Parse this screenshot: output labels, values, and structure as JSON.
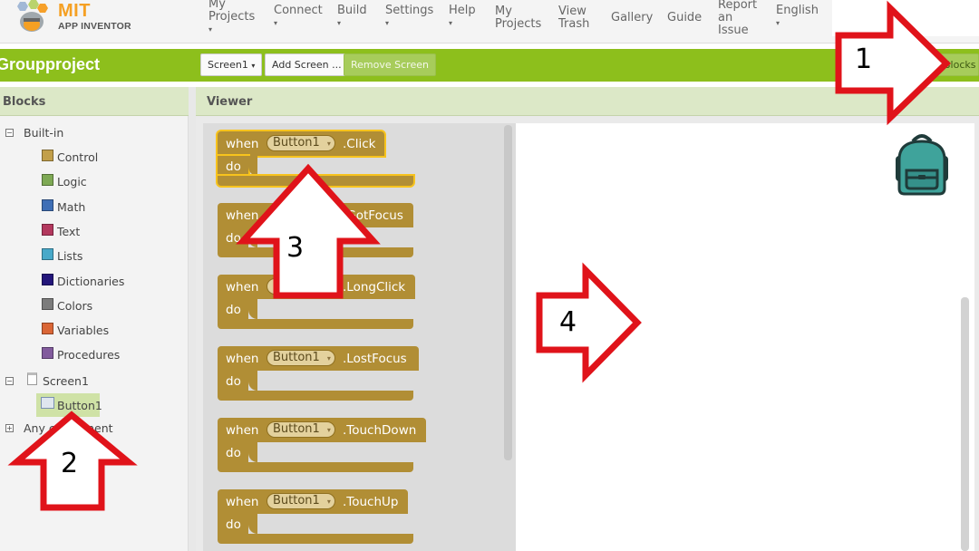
{
  "topnav": {
    "logo_line1": "MIT",
    "logo_line2": "APP INVENTOR",
    "items": [
      {
        "label": "My\nProjects",
        "dropdown": true
      },
      {
        "label": "Connect",
        "dropdown": true
      },
      {
        "label": "Build",
        "dropdown": true
      },
      {
        "label": "Settings",
        "dropdown": true
      },
      {
        "label": "Help",
        "dropdown": true
      },
      {
        "label": "My\nProjects",
        "dropdown": false
      },
      {
        "label": "View\nTrash",
        "dropdown": false
      },
      {
        "label": "Gallery",
        "dropdown": false
      },
      {
        "label": "Guide",
        "dropdown": false
      },
      {
        "label": "Report\nan\nIssue",
        "dropdown": false
      },
      {
        "label": "English",
        "dropdown": true
      }
    ]
  },
  "projectbar": {
    "title": "Groupproject",
    "screen_select": "Screen1",
    "add_screen": "Add Screen ...",
    "remove_screen": "Remove Screen",
    "blocks_button": "Blocks",
    "accent_color": "#8dbf1c"
  },
  "blocks_panel": {
    "header": "Blocks",
    "builtin_label": "Built-in",
    "categories": [
      {
        "label": "Control",
        "color": "#c29f4a"
      },
      {
        "label": "Logic",
        "color": "#7ea954"
      },
      {
        "label": "Math",
        "color": "#3f6fb6"
      },
      {
        "label": "Text",
        "color": "#b3385e"
      },
      {
        "label": "Lists",
        "color": "#48a9c9"
      },
      {
        "label": "Dictionaries",
        "color": "#23167a"
      },
      {
        "label": "Colors",
        "color": "#7c7c7c"
      },
      {
        "label": "Variables",
        "color": "#da6636"
      },
      {
        "label": "Procedures",
        "color": "#825b9d"
      }
    ],
    "screen_label": "Screen1",
    "button_label": "Button1",
    "any_component_label": "Any component"
  },
  "viewer": {
    "header": "Viewer",
    "blocks": [
      {
        "when": "when",
        "component": "Button1",
        "event": ".Click",
        "do": "do",
        "selected": true
      },
      {
        "when": "when",
        "component": "Button1",
        "event": ".GotFocus",
        "do": "do",
        "selected": false
      },
      {
        "when": "when",
        "component": "Button1",
        "event": ".LongClick",
        "do": "do",
        "selected": false
      },
      {
        "when": "when",
        "component": "Button1",
        "event": ".LostFocus",
        "do": "do",
        "selected": false
      },
      {
        "when": "when",
        "component": "Button1",
        "event": ".TouchDown",
        "do": "do",
        "selected": false
      },
      {
        "when": "when",
        "component": "Button1",
        "event": ".TouchUp",
        "do": "do",
        "selected": false
      }
    ]
  },
  "callouts": [
    "1",
    "2",
    "3",
    "4"
  ],
  "icons": {
    "backpack": "backpack-icon",
    "logo": "app-inventor-logo-icon"
  }
}
